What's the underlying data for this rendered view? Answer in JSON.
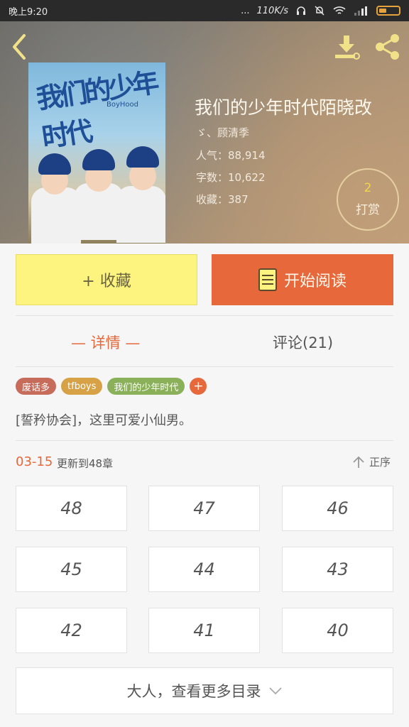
{
  "status_bar": {
    "time": "晚上9:20",
    "dots": "...",
    "speed": "110K/s",
    "icons": [
      "headphone-icon",
      "mute-bell-icon",
      "wifi-icon",
      "signal-icon",
      "battery-icon"
    ]
  },
  "header": {
    "icons": [
      "back-arrow-icon",
      "download-icon",
      "share-icon"
    ],
    "book": {
      "title": "我们的少年时代陌晓改",
      "author": "ゞ、顾清季",
      "popularity": "人气：88,914",
      "word_count": "字数：10,622",
      "favorites": "收藏：387"
    },
    "cover_art": {
      "title": "我们的少年时代",
      "subtitle": "BoyHood"
    },
    "reward": {
      "count": "2",
      "label": "打赏"
    }
  },
  "actions": {
    "collect_label": "+ 收藏",
    "read_label": "开始阅读"
  },
  "tabs": {
    "details": "— 详情 —",
    "comments": "评论(21)"
  },
  "tags": [
    {
      "label": "废话多",
      "color": "#c76b5a"
    },
    {
      "label": "tfboys",
      "color": "#d7a246"
    },
    {
      "label": "我们的少年时代",
      "color": "#8bb05a"
    }
  ],
  "tag_add": "+",
  "intro": "[誓矜协会]，这里可爱小仙男。",
  "update": {
    "date": "03-15",
    "text": "更新到48章",
    "sort_label": "正序"
  },
  "chapters": [
    "48",
    "47",
    "46",
    "45",
    "44",
    "43",
    "42",
    "41",
    "40"
  ],
  "more_label": "大人，查看更多目录",
  "colors": {
    "accent": "#e6683b",
    "collect": "#fdf47f",
    "icon_yellow": "#f1e28a"
  }
}
